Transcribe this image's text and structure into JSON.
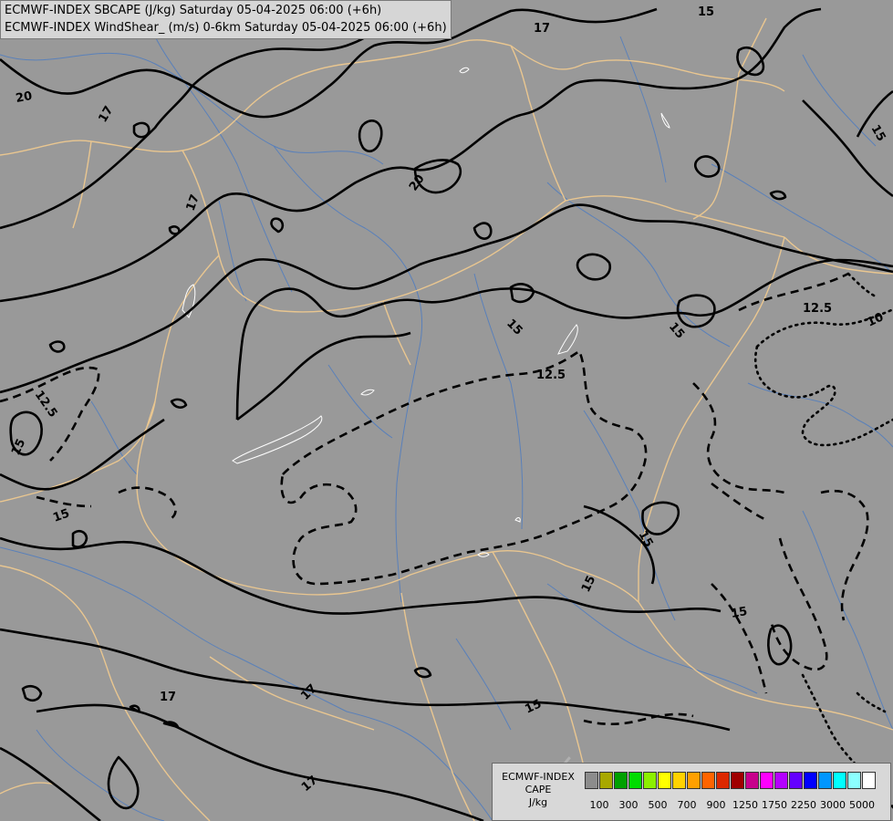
{
  "header": {
    "line1": "ECMWF-INDEX SBCAPE (J/kg) Saturday 05-04-2025 06:00 (+6h)",
    "line2": "ECMWF-INDEX WindShear_ (m/s) 0-6km Saturday 05-04-2025 06:00 (+6h)"
  },
  "contour_labels": [
    "17",
    "15",
    "20",
    "17",
    "17",
    "20",
    "15",
    "15",
    "12.5",
    "12.5",
    "10",
    "15",
    "12.5",
    "15",
    "15",
    "15",
    "15",
    "15",
    "17",
    "17",
    "17",
    "15"
  ],
  "legend": {
    "title_line1": "ECMWF-INDEX",
    "title_line2": "CAPE",
    "units": "J/kg",
    "colors": [
      "#8c8c8c",
      "#a8a800",
      "#00a000",
      "#00dc00",
      "#8cf000",
      "#ffff00",
      "#ffd200",
      "#ffa000",
      "#ff6400",
      "#dc2800",
      "#a00000",
      "#c8008c",
      "#ff00ff",
      "#b400ff",
      "#6400ff",
      "#0000ff",
      "#0096ff",
      "#00ffff",
      "#8cffff",
      "#ffffff"
    ],
    "tick_labels": [
      "100",
      "300",
      "500",
      "700",
      "900",
      "1250",
      "1750",
      "2250",
      "3000",
      "5000"
    ]
  }
}
